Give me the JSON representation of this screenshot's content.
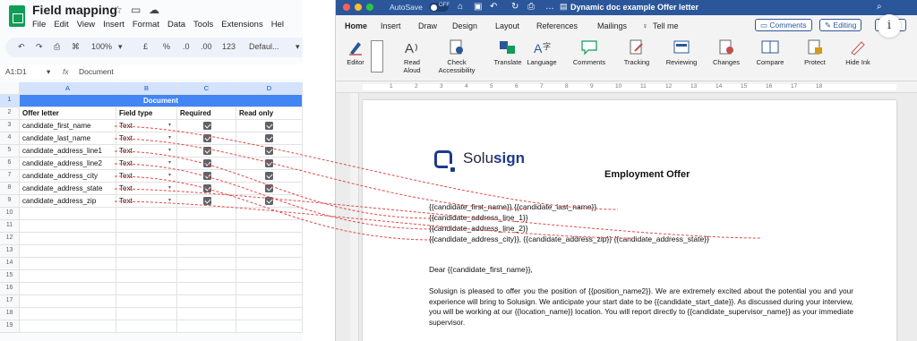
{
  "sheets": {
    "title": "Field mapping",
    "menu": [
      "File",
      "Edit",
      "View",
      "Insert",
      "Format",
      "Data",
      "Tools",
      "Extensions",
      "Hel"
    ],
    "toolbar": {
      "zoom": "100%",
      "currency": "£",
      "percent": "%",
      "decimals": ".0",
      "number": "123",
      "font": "Defaul..."
    },
    "name_box": "A1:D1",
    "formula": "Document",
    "columns": [
      "A",
      "B",
      "C",
      "D"
    ],
    "banner": "Document",
    "headers": [
      "Offer letter",
      "Field type",
      "Required",
      "Read only"
    ],
    "rows": [
      {
        "field": "candidate_first_name",
        "type": "Text",
        "required": true,
        "read_only": true
      },
      {
        "field": "candidate_last_name",
        "type": "Text",
        "required": true,
        "read_only": true
      },
      {
        "field": "candidate_address_line1",
        "type": "Text",
        "required": true,
        "read_only": true
      },
      {
        "field": "candidate_address_line2",
        "type": "Text",
        "required": true,
        "read_only": true
      },
      {
        "field": "candidate_address_city",
        "type": "Text",
        "required": true,
        "read_only": true
      },
      {
        "field": "candidate_address_state",
        "type": "Text",
        "required": true,
        "read_only": true
      },
      {
        "field": "candidate_address_zip",
        "type": "Text",
        "required": true,
        "read_only": true
      }
    ],
    "row_numbers": [
      "1",
      "2",
      "3",
      "4",
      "5",
      "6",
      "7",
      "8",
      "9",
      "10",
      "11",
      "12",
      "13",
      "14",
      "15",
      "16",
      "17",
      "18",
      "19"
    ]
  },
  "word": {
    "autosave": "AutoSave",
    "autosave_state": "OFF",
    "doc_title": "Dynamic doc example Offer letter",
    "tabs": [
      "Home",
      "Insert",
      "Draw",
      "Design",
      "Layout",
      "References",
      "Mailings",
      "Tell me"
    ],
    "comments_button": "Comments",
    "editing_button": "Editing",
    "share_button": "Share",
    "ribbon": [
      {
        "label": "Editor",
        "icon": "editor-pen-icon"
      },
      {
        "label": "Read\nAloud",
        "icon": "read-aloud-icon"
      },
      {
        "label": "Check\nAccessibility",
        "icon": "accessibility-icon"
      },
      {
        "label": "Translate",
        "icon": "translate-icon"
      },
      {
        "label": "Language",
        "icon": "language-icon"
      },
      {
        "label": "Comments",
        "icon": "comments-icon"
      },
      {
        "label": "Tracking",
        "icon": "tracking-icon"
      },
      {
        "label": "Reviewing",
        "icon": "reviewing-icon"
      },
      {
        "label": "Changes",
        "icon": "changes-icon"
      },
      {
        "label": "Compare",
        "icon": "compare-icon"
      },
      {
        "label": "Protect",
        "icon": "protect-icon"
      },
      {
        "label": "Hide Ink",
        "icon": "hide-ink-icon"
      }
    ],
    "ruler_marks": [
      "1",
      "2",
      "3",
      "4",
      "5",
      "6",
      "7",
      "8",
      "9",
      "10",
      "11",
      "12",
      "13",
      "14",
      "15",
      "16",
      "17",
      "18"
    ],
    "document": {
      "logo_plain": "Solu",
      "logo_bold": "sign",
      "heading": "Employment Offer",
      "address_lines": [
        "{{candidate_first_name}} {{candidate_last_name}}",
        "{{candidate_address_line_1}}",
        "{{candidate_address_line_2}}",
        "{{candidate_address_city}}, {{candidate_address_zip}} {{candidate_address_state}}"
      ],
      "greeting": "Dear {{candidate_first_name}},",
      "body": "Solusign is pleased to offer you the position of {{position_name2}}. We are extremely excited about the potential you and your experience will bring to Solusign. We anticipate your start date to be {{candidate_start_date}}. As discussed during your interview, you will be working at our {{location_name}} location. You will report directly to {{candidate_supervisor_name}} as your immediate supervisor."
    }
  },
  "overlay": {
    "info_label": "i",
    "connector_color": "#e24a4a"
  }
}
